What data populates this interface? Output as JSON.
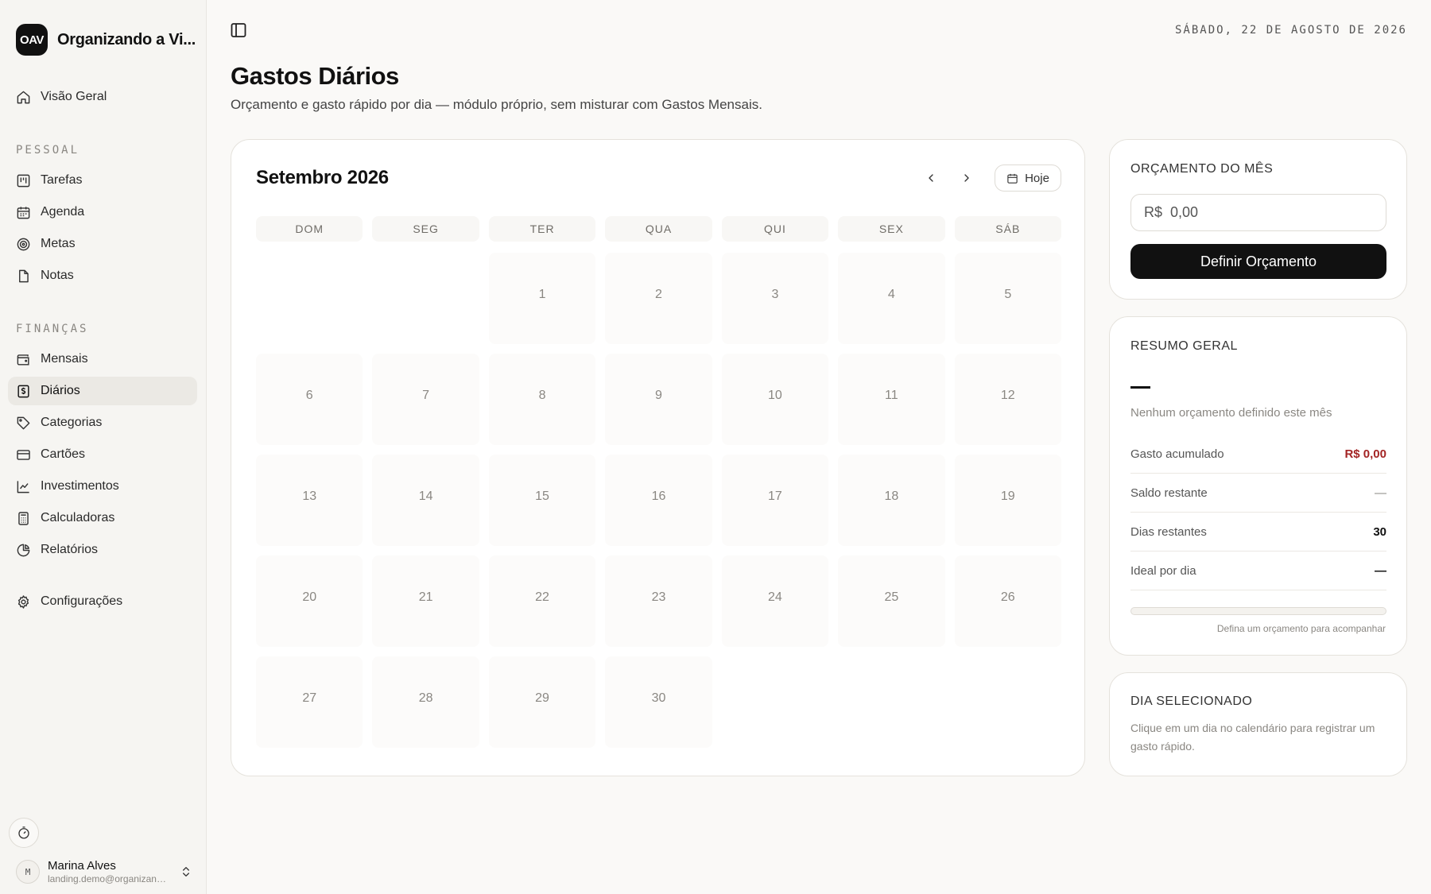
{
  "brand": {
    "logo": "OAV",
    "name": "Organizando a Vi..."
  },
  "sidebar": {
    "overview": {
      "label": "Visão Geral",
      "icon": "home-icon"
    },
    "sections": [
      {
        "label": "PESSOAL"
      },
      {
        "label": "FINANÇAS"
      }
    ],
    "personal": [
      {
        "label": "Tarefas",
        "icon": "kanban-icon"
      },
      {
        "label": "Agenda",
        "icon": "calendar-icon"
      },
      {
        "label": "Metas",
        "icon": "target-icon"
      },
      {
        "label": "Notas",
        "icon": "file-icon"
      }
    ],
    "finance": [
      {
        "label": "Mensais",
        "icon": "wallet-icon"
      },
      {
        "label": "Diários",
        "icon": "receipt-dollar-icon",
        "active": true
      },
      {
        "label": "Categorias",
        "icon": "tag-icon"
      },
      {
        "label": "Cartões",
        "icon": "credit-card-icon"
      },
      {
        "label": "Investimentos",
        "icon": "line-chart-icon"
      },
      {
        "label": "Calculadoras",
        "icon": "calculator-icon"
      },
      {
        "label": "Relatórios",
        "icon": "pie-chart-icon"
      }
    ],
    "settings": {
      "label": "Configurações",
      "icon": "gear-icon"
    }
  },
  "user": {
    "initial": "M",
    "name": "Marina Alves",
    "email": "landing.demo@organizandoavida.com"
  },
  "header": {
    "date": "SÁBADO, 22 DE AGOSTO DE 2026"
  },
  "page": {
    "title": "Gastos Diários",
    "subtitle": "Orçamento e gasto rápido por dia — módulo próprio, sem misturar com Gastos Mensais."
  },
  "calendar": {
    "title": "Setembro 2026",
    "today_label": "Hoje",
    "weekdays": [
      "DOM",
      "SEG",
      "TER",
      "QUA",
      "QUI",
      "SEX",
      "SÁB"
    ],
    "first_weekday_index": 2,
    "days": [
      "1",
      "2",
      "3",
      "4",
      "5",
      "6",
      "7",
      "8",
      "9",
      "10",
      "11",
      "12",
      "13",
      "14",
      "15",
      "16",
      "17",
      "18",
      "19",
      "20",
      "21",
      "22",
      "23",
      "24",
      "25",
      "26",
      "27",
      "28",
      "29",
      "30"
    ]
  },
  "budget": {
    "title": "ORÇAMENTO DO MÊS",
    "input_placeholder": "R$  0,00",
    "button_label": "Definir Orçamento"
  },
  "summary": {
    "title": "RESUMO GERAL",
    "headline": "—",
    "no_budget": "Nenhum orçamento definido este mês",
    "rows": [
      {
        "label": "Gasto acumulado",
        "value": "R$ 0,00",
        "tone": "red"
      },
      {
        "label": "Saldo restante",
        "value": "—",
        "tone": "light"
      },
      {
        "label": "Dias restantes",
        "value": "30",
        "tone": "normal"
      },
      {
        "label": "Ideal por dia",
        "value": "—",
        "tone": "normal"
      }
    ],
    "progress": 0,
    "progress_hint": "Defina um orçamento para acompanhar"
  },
  "selected_day": {
    "title": "DIA SELECIONADO",
    "hint": "Clique em um dia no calendário para registrar um gasto rápido."
  },
  "colors": {
    "accent": "#111111",
    "negative": "#a32424",
    "background": "#faf9f7"
  }
}
